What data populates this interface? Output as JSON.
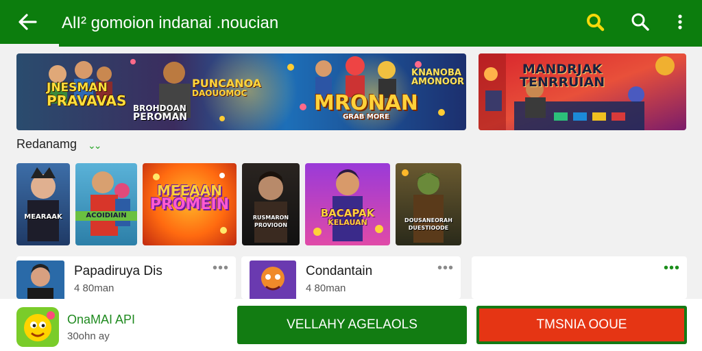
{
  "header": {
    "title": "AlI² gomoion indanai .noucian",
    "back_icon": "back-arrow-icon",
    "icons": [
      "search-icon-yellow",
      "search-icon",
      "more-vertical-icon"
    ],
    "background": "#0c7d0d"
  },
  "banners": [
    {
      "title_lines": [
        "JNESMAN",
        "PRAVAVAS"
      ],
      "mid_lines": [
        "PUNCANOA",
        "DAOUOMOC"
      ],
      "sub_lines": [
        "BROHDOAN",
        "PEROMAN"
      ],
      "main": "MRONAN",
      "main_sub": "GRAB MORE",
      "side_lines": [
        "KNANOBA",
        "AMONOOR"
      ]
    },
    {
      "title_lines": [
        "MANDRJAK",
        "TENRRUIAN"
      ]
    }
  ],
  "section": {
    "label": "Redanamg",
    "chevron": "⌄⌄"
  },
  "tiles": [
    {
      "lines": [
        "MEARAAK"
      ]
    },
    {
      "lines": [
        "ACOIDIAIN"
      ]
    },
    {
      "lines": [
        "MEEAAN",
        "PROMEIN"
      ]
    },
    {
      "lines": [
        "RUSMARON",
        "PROVIOON"
      ]
    },
    {
      "lines": [
        "BACAPAK",
        "KELAUAN"
      ]
    },
    {
      "lines": [
        "DOUSANEORAH",
        "DUESTIOODE"
      ]
    }
  ],
  "cards": [
    {
      "title": "Papadiruya Dis",
      "subtitle": "4 80man",
      "more": "•••"
    },
    {
      "title": "Condantain",
      "subtitle": "4 80man",
      "more": "•••"
    },
    {
      "title": "",
      "subtitle": "",
      "more": "•••"
    }
  ],
  "bottom": {
    "app_name": "OnaMAI API",
    "app_size": "30ohn ay",
    "primary_button": "VELLAHY AGELAOLS",
    "secondary_button": "TMSNIA OOUE"
  },
  "colors": {
    "brand_green": "#0c7d0d",
    "accent_red": "#e53514",
    "more_green": "#1b8e1b"
  }
}
